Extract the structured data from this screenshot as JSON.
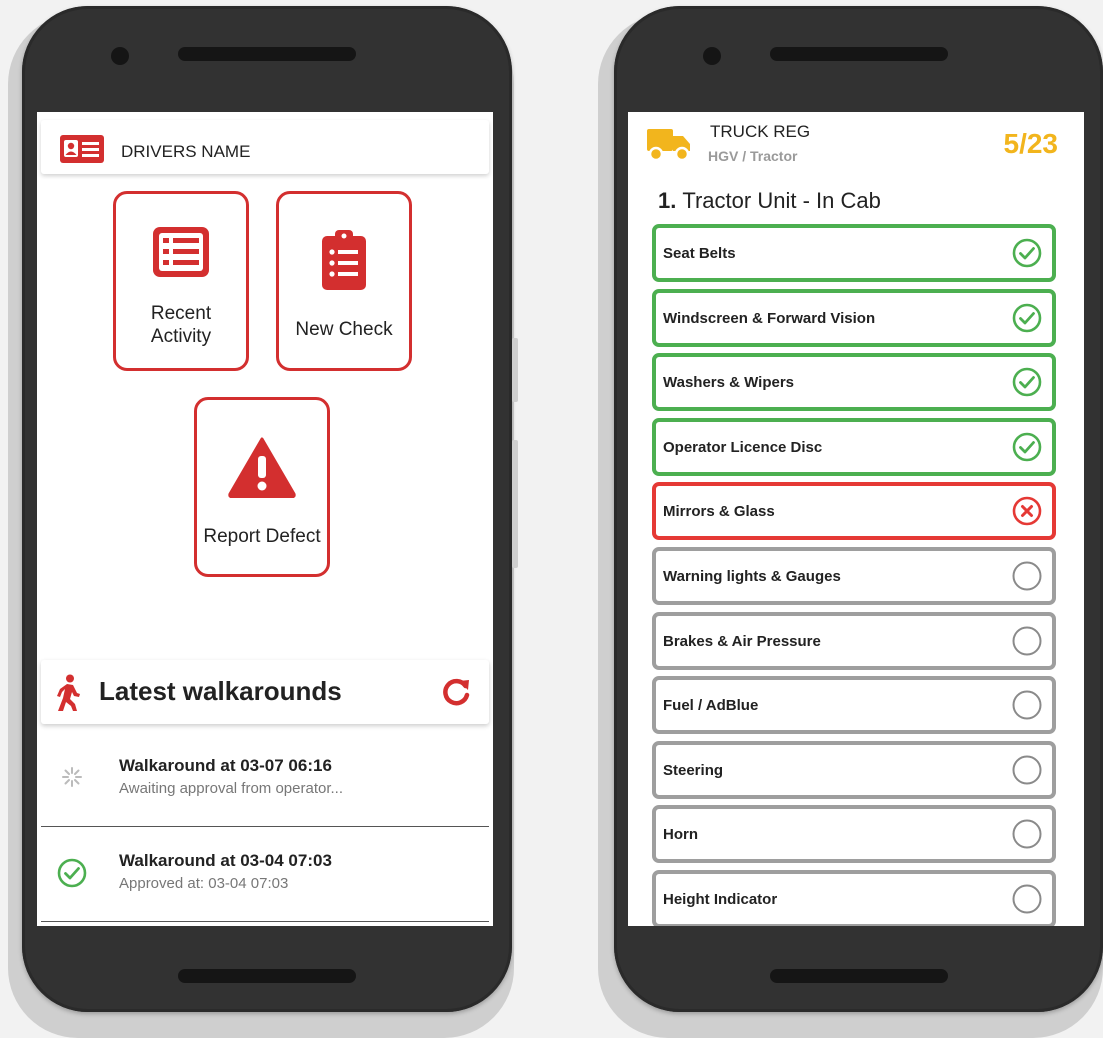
{
  "left_screen": {
    "driver_name": "DRIVERS NAME",
    "tiles": {
      "recent_activity": "Recent Activity",
      "new_check": "New Check",
      "report_defect": "Report Defect"
    },
    "latest": {
      "title": "Latest walkarounds",
      "refresh_icon": "refresh-icon",
      "items": [
        {
          "title": "Walkaround at 03-07 06:16",
          "subtitle": "Awaiting approval from operator...",
          "status": "pending"
        },
        {
          "title": "Walkaround at 03-04 07:03",
          "subtitle": "Approved at: 03-04 07:03",
          "status": "approved"
        }
      ]
    }
  },
  "right_screen": {
    "truck_reg": "TRUCK REG",
    "vehicle_type": "HGV / Tractor",
    "progress": "5/23",
    "section_number": "1.",
    "section_title": "Tractor Unit - In Cab",
    "items": [
      {
        "label": "Seat Belts",
        "status": "pass"
      },
      {
        "label": "Windscreen & Forward Vision",
        "status": "pass"
      },
      {
        "label": "Washers & Wipers",
        "status": "pass"
      },
      {
        "label": "Operator Licence Disc",
        "status": "pass"
      },
      {
        "label": "Mirrors & Glass",
        "status": "fail"
      },
      {
        "label": "Warning lights & Gauges",
        "status": "unchecked"
      },
      {
        "label": "Brakes & Air Pressure",
        "status": "unchecked"
      },
      {
        "label": "Fuel / AdBlue",
        "status": "unchecked"
      },
      {
        "label": "Steering",
        "status": "unchecked"
      },
      {
        "label": "Horn",
        "status": "unchecked"
      },
      {
        "label": "Height Indicator",
        "status": "unchecked"
      }
    ]
  },
  "colors": {
    "brand_red": "#d32f2f",
    "pass_green": "#4caf50",
    "fail_red": "#e53935",
    "unchecked_grey": "#9e9e9e",
    "accent_yellow": "#f2b51d"
  }
}
